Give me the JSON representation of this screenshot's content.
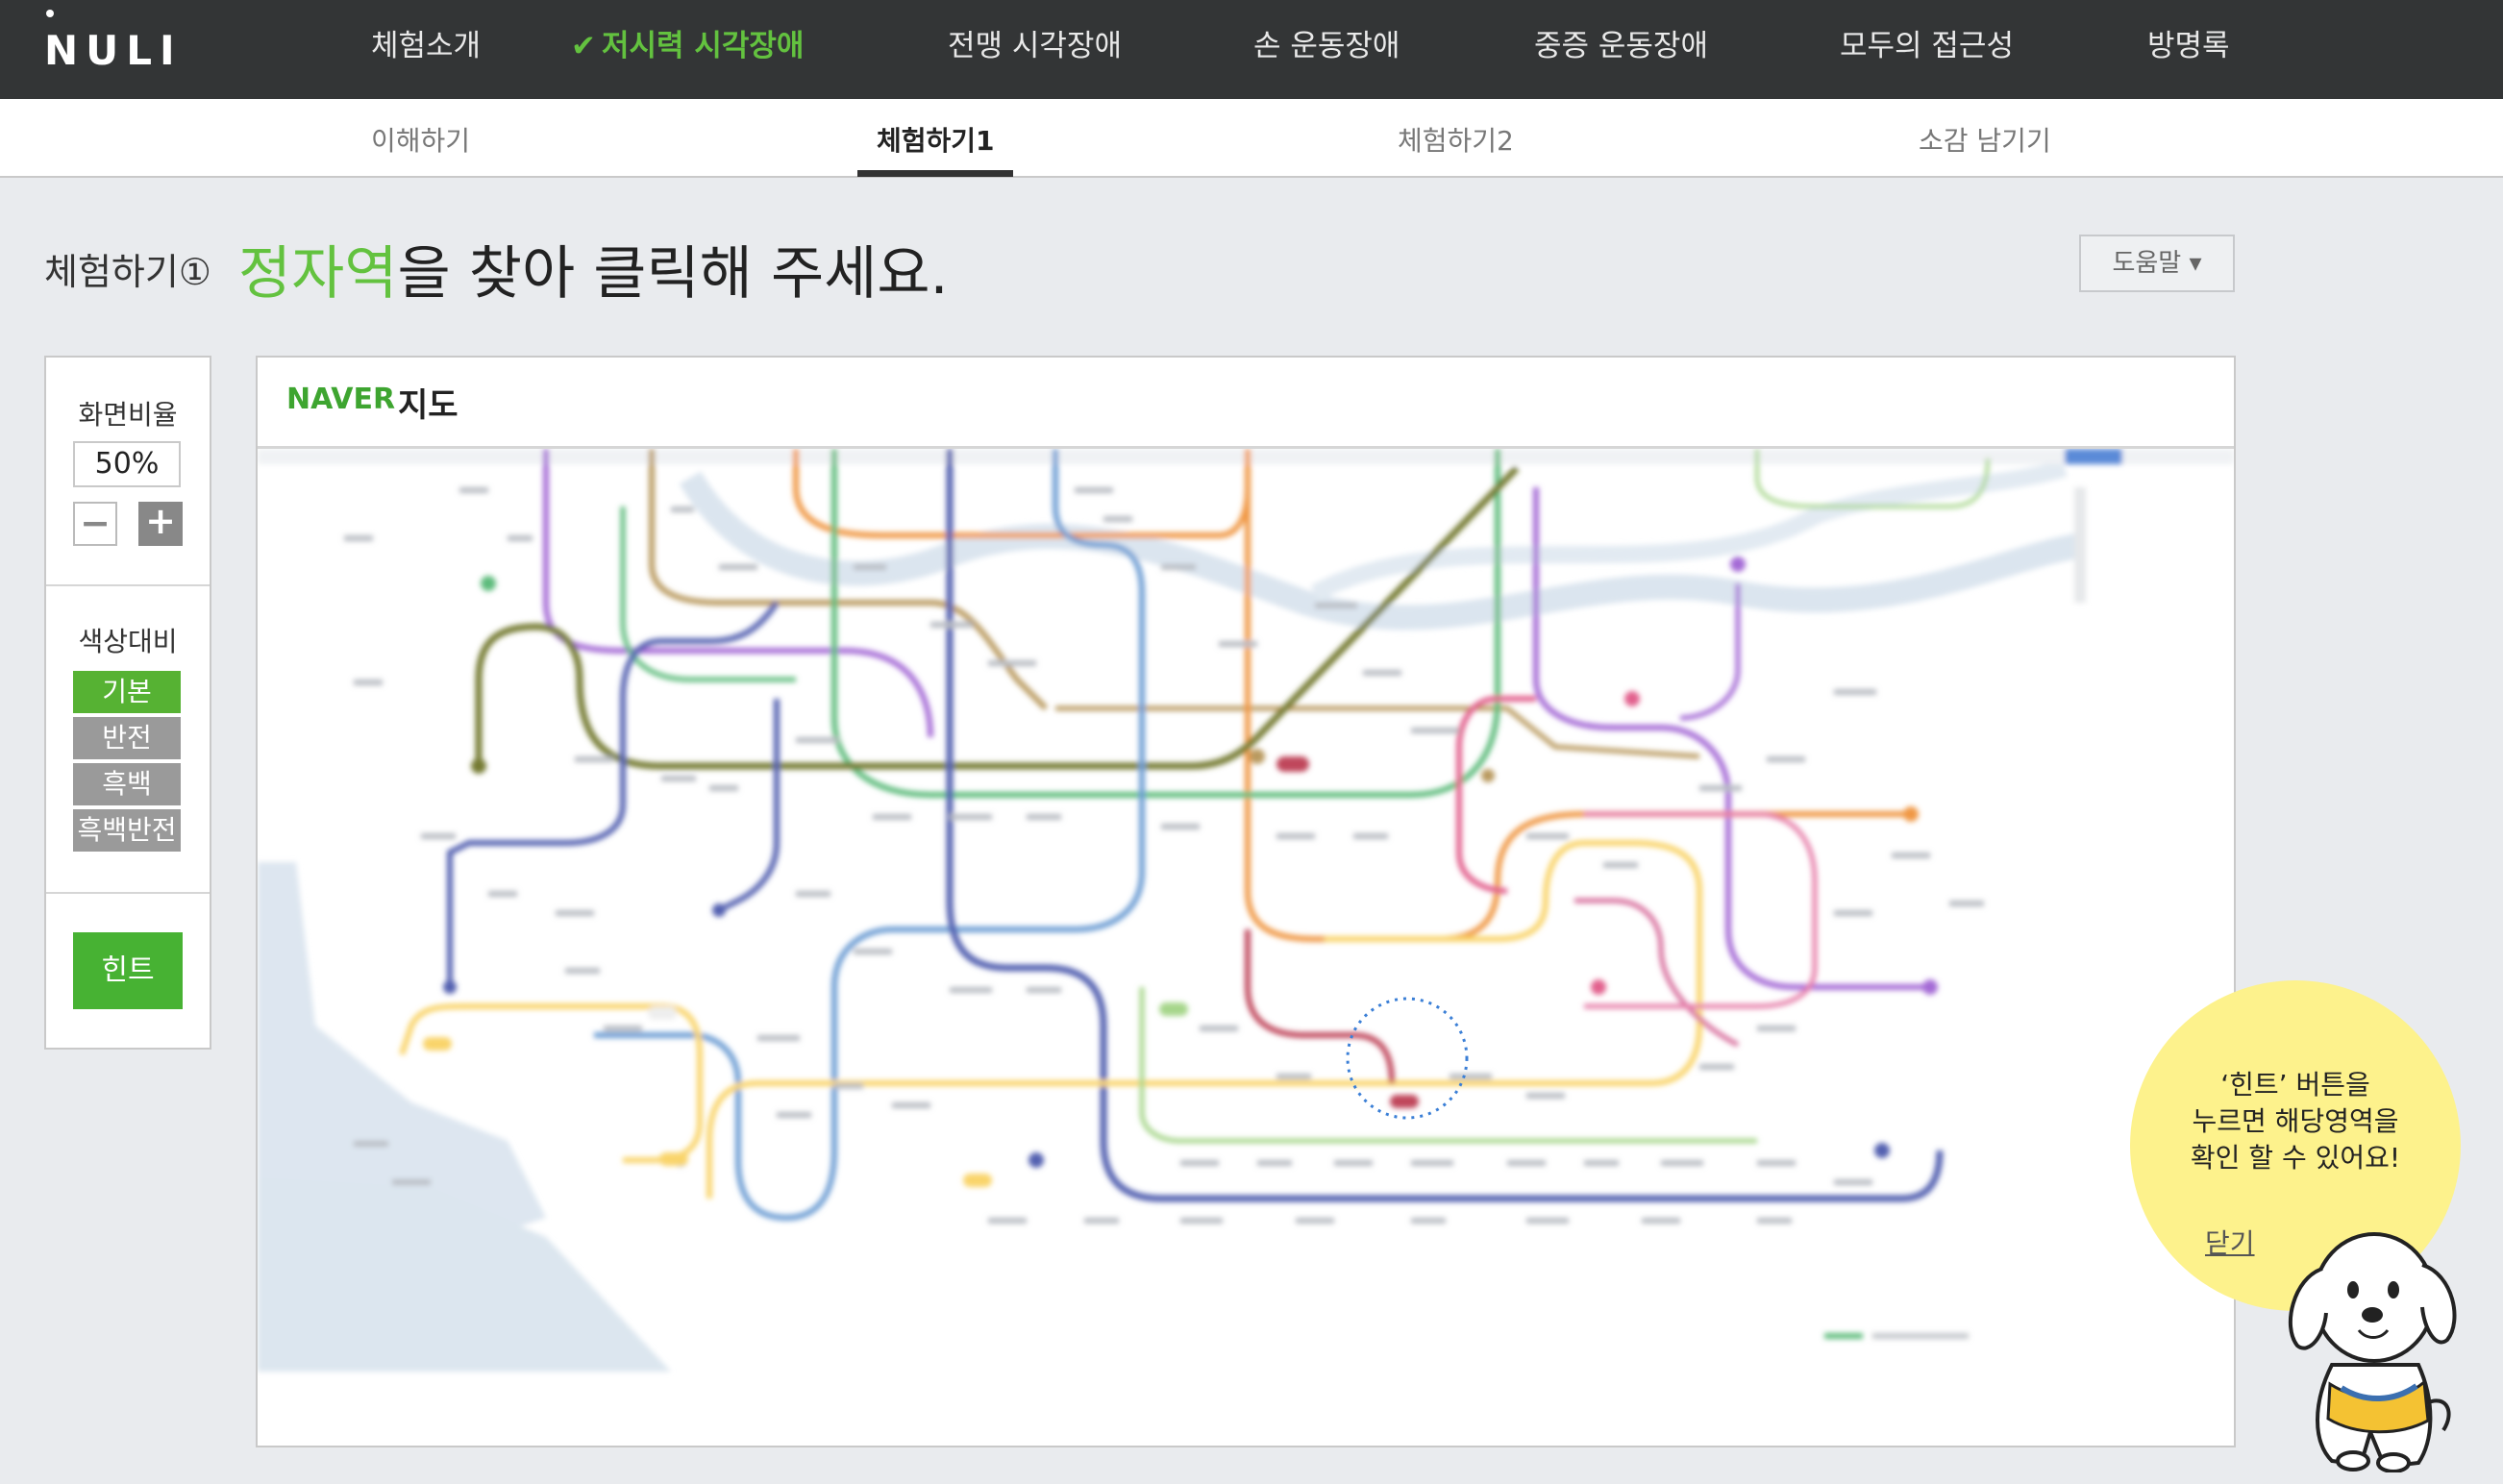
{
  "logo": "NULI",
  "topnav": {
    "items": [
      {
        "label": "체험소개"
      },
      {
        "label": "저시력 시각장애",
        "active": true
      },
      {
        "label": "전맹 시각장애"
      },
      {
        "label": "손 운동장애"
      },
      {
        "label": "중증 운동장애"
      },
      {
        "label": "모두의 접근성"
      },
      {
        "label": "방명록"
      }
    ]
  },
  "subnav": {
    "items": [
      {
        "label": "이해하기"
      },
      {
        "label": "체험하기1",
        "active": true
      },
      {
        "label": "체험하기2"
      },
      {
        "label": "소감 남기기"
      }
    ]
  },
  "heading": {
    "step": "체험하기①",
    "target": "정자역",
    "rest": "을 찾아 클릭해 주세요."
  },
  "help_button": "도움말 ▾",
  "left_panel": {
    "ratio_label": "화면비율",
    "ratio_value": "50%",
    "contrast_label": "색상대비",
    "contrast_options": [
      "기본",
      "반전",
      "흑백",
      "흑백반전"
    ],
    "hint_button": "힌트"
  },
  "map": {
    "brand": "NAVER",
    "title": "지도"
  },
  "hint_bubble": {
    "line1": "‘힌트’ 버튼을",
    "line2": "누르면 해당영역을",
    "line3": "확인 할 수 있어요!",
    "close": "닫기"
  },
  "colors": {
    "accent_green": "#63c23f",
    "nav_bg": "#333536",
    "bubble_yellow": "#fdf28c"
  }
}
